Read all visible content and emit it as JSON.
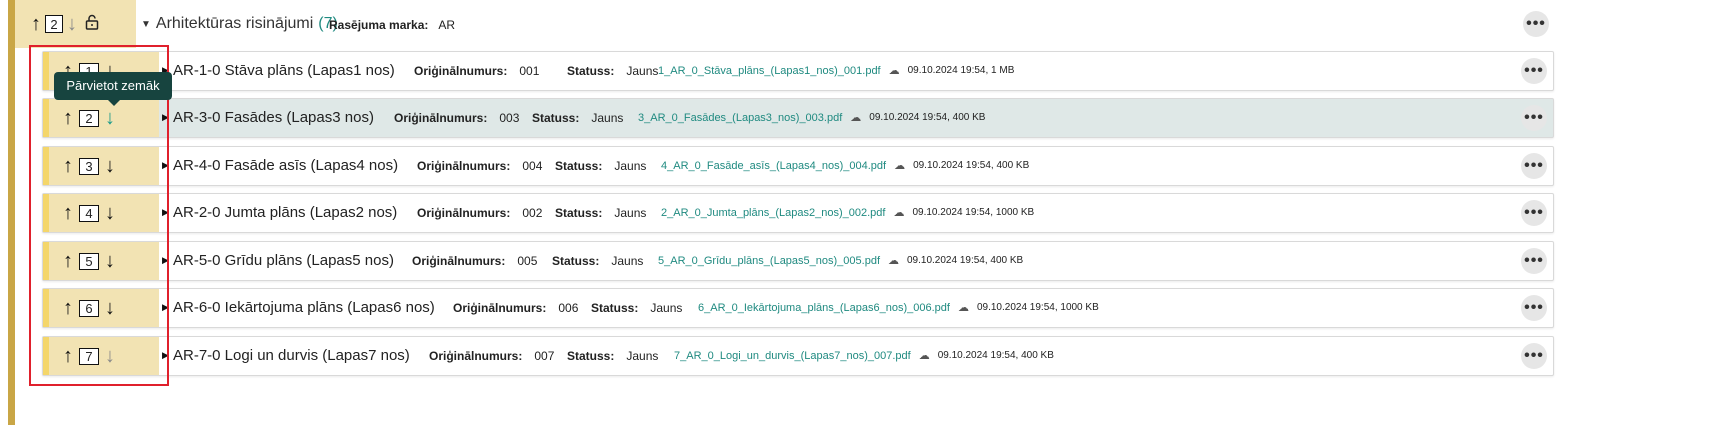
{
  "group": {
    "order": "2",
    "title": "Arhitektūras risinājumi",
    "count": "(7)",
    "marka_label": "Rasējuma marka:",
    "marka_value": "AR",
    "icons": {
      "up": "arrow-up-icon",
      "down": "arrow-down-icon",
      "lock": "unlock-icon",
      "expand": "caret-down-icon",
      "more": "more-icon"
    }
  },
  "labels": {
    "original": "Oriģinālnumurs:",
    "status": "Statuss:"
  },
  "tooltip": "Pārvietot zemāk",
  "rows": [
    {
      "order": "1",
      "title": "AR-1-0 Stāva plāns (Lapas1 nos)",
      "original": "001",
      "status": "Jauns",
      "file": "1_AR_0_Stāva_plāns_(Lapas1_nos)_001.pdf",
      "info": "09.10.2024 19:54, 1 MB"
    },
    {
      "order": "2",
      "title": "AR-3-0 Fasādes (Lapas3 nos)",
      "original": "003",
      "status": "Jauns",
      "file": "3_AR_0_Fasādes_(Lapas3_nos)_003.pdf",
      "info": "09.10.2024 19:54, 400 KB"
    },
    {
      "order": "3",
      "title": "AR-4-0 Fasāde asīs (Lapas4 nos)",
      "original": "004",
      "status": "Jauns",
      "file": "4_AR_0_Fasāde_asīs_(Lapas4_nos)_004.pdf",
      "info": "09.10.2024 19:54, 400 KB"
    },
    {
      "order": "4",
      "title": "AR-2-0 Jumta plāns (Lapas2 nos)",
      "original": "002",
      "status": "Jauns",
      "file": "2_AR_0_Jumta_plāns_(Lapas2_nos)_002.pdf",
      "info": "09.10.2024 19:54, 1000 KB"
    },
    {
      "order": "5",
      "title": "AR-5-0 Grīdu plāns (Lapas5 nos)",
      "original": "005",
      "status": "Jauns",
      "file": "5_AR_0_Grīdu_plāns_(Lapas5_nos)_005.pdf",
      "info": "09.10.2024 19:54, 400 KB"
    },
    {
      "order": "6",
      "title": "AR-6-0 Iekārtojuma plāns (Lapas6 nos)",
      "original": "006",
      "status": "Jauns",
      "file": "6_AR_0_Iekārtojuma_plāns_(Lapas6_nos)_006.pdf",
      "info": "09.10.2024 19:54, 1000 KB"
    },
    {
      "order": "7",
      "title": "AR-7-0 Logi un durvis (Lapas7 nos)",
      "original": "007",
      "status": "Jauns",
      "file": "7_AR_0_Logi_un_durvis_(Lapas7_nos)_007.pdf",
      "info": "09.10.2024 19:54, 400 KB"
    }
  ]
}
